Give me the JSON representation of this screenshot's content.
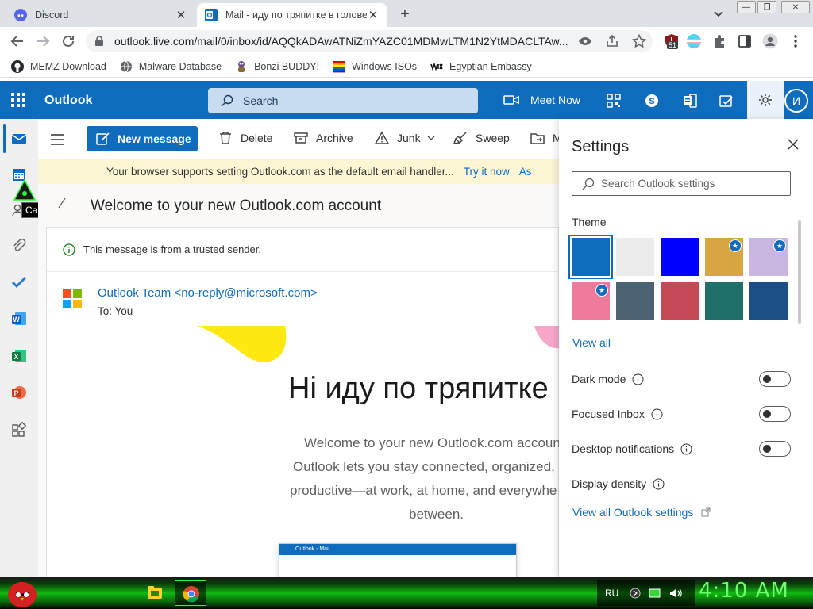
{
  "browser": {
    "tabs": [
      {
        "title": "Discord",
        "active": false,
        "icon": "discord-icon"
      },
      {
        "title": "Mail - иду по тряпитке в голове",
        "active": true,
        "icon": "outlook-icon"
      }
    ],
    "url": "outlook.live.com/mail/0/inbox/id/AQQkADAwATNiZmYAZC01MDMwLTM1N2YtMDACLTAw...",
    "extension_badge": "51",
    "bookmarks": [
      {
        "label": "MEMZ Download",
        "icon": "github-icon"
      },
      {
        "label": "Malware Database",
        "icon": "globe-icon"
      },
      {
        "label": "Bonzi BUDDY!",
        "icon": "bonzi-icon"
      },
      {
        "label": "Windows ISOs",
        "icon": "windows-flag-icon"
      },
      {
        "label": "Egyptian Embassy",
        "icon": "wix-icon"
      }
    ]
  },
  "outlook": {
    "brand": "Outlook",
    "search_placeholder": "Search",
    "meet_now": "Meet Now",
    "avatar_initials": "И",
    "accent_color": "#0f6cbd"
  },
  "commands": {
    "new_message": "New message",
    "delete": "Delete",
    "archive": "Archive",
    "junk": "Junk",
    "sweep": "Sweep",
    "move_partial": "M"
  },
  "infobar": {
    "text": "Your browser supports setting Outlook.com as the default email handler...",
    "link": "Try it now",
    "trailing": "As"
  },
  "tooltip": "Calendar",
  "message": {
    "subject": "Welcome to your new Outlook.com account",
    "trusted_notice": "This message is from a trusted sender.",
    "sender": "Outlook Team <no-reply@microsoft.com>",
    "to": "To:  You",
    "heading": "Ні иду по тряпитке",
    "body_lines": [
      "Welcome to your new Outlook.com accoun",
      "Outlook lets you stay connected, organized, a",
      "productive—at work, at home, and everywhe",
      "between."
    ],
    "thumb_title": "Outlook - Mail"
  },
  "settings": {
    "title": "Settings",
    "search_placeholder": "Search Outlook settings",
    "theme_label": "Theme",
    "view_all": "View all",
    "dark_mode": "Dark mode",
    "focused_inbox": "Focused Inbox",
    "desktop_notifications": "Desktop notifications",
    "display_density": "Display density",
    "view_all_settings": "View all Outlook settings",
    "themes": [
      {
        "name": "blue",
        "color": "#0f6cbd",
        "selected": true
      },
      {
        "name": "light-gray",
        "color": "#ebebeb"
      },
      {
        "name": "bright-blue",
        "color": "#0000ff"
      },
      {
        "name": "rainbow-art",
        "color": "#d7a542",
        "premium": true
      },
      {
        "name": "feathers",
        "color": "#c9b6e0",
        "premium": true
      },
      {
        "name": "colorful-art",
        "color": "#f07a9b",
        "premium": true
      },
      {
        "name": "mountain",
        "color": "#4a6272"
      },
      {
        "name": "palm-sunset",
        "color": "#c44a57"
      },
      {
        "name": "circuit",
        "color": "#1f6f6a"
      },
      {
        "name": "innovation",
        "color": "#1c4f86"
      }
    ]
  },
  "taskbar": {
    "language": "RU",
    "clock": "4:10 AM"
  }
}
